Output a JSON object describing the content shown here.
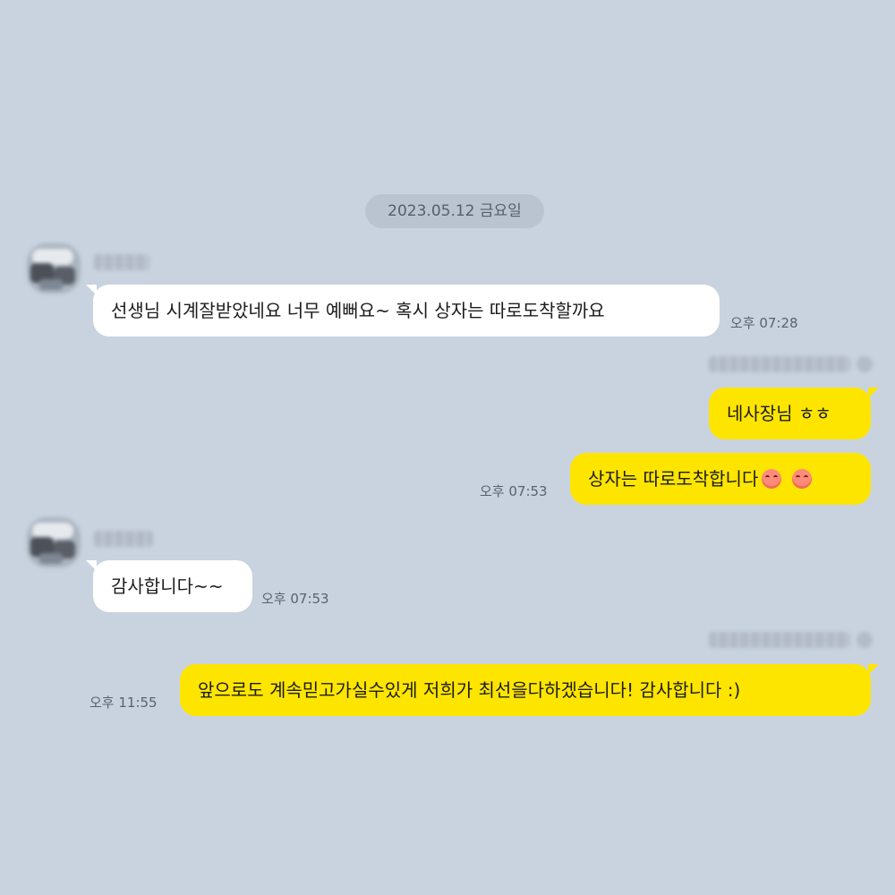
{
  "date_divider": "2023.05.12 금요일",
  "messages": [
    {
      "side": "in",
      "text": "선생님 시계잘받았네요 너무 예뻐요~ 혹시 상자는 따로도착할까요",
      "time": "오후 07:28"
    },
    {
      "side": "out",
      "text": "네사장님 ㅎㅎ",
      "time": ""
    },
    {
      "side": "out",
      "text": "상자는 따로도착합니다",
      "time": "오후 07:53",
      "emojis": [
        "smiling-face-icon",
        "smiling-face-icon"
      ]
    },
    {
      "side": "in",
      "text": "감사합니다~~",
      "time": "오후 07:53"
    },
    {
      "side": "out",
      "text": "앞으로도 계속믿고가실수있게 저희가 최선을다하겠습니다! 감사합니다 :)",
      "time": "오후 11:55"
    }
  ],
  "colors": {
    "background": "#c9d3df",
    "incoming_bubble": "#ffffff",
    "outgoing_bubble": "#fee500",
    "date_pill": "#bac4d0"
  }
}
